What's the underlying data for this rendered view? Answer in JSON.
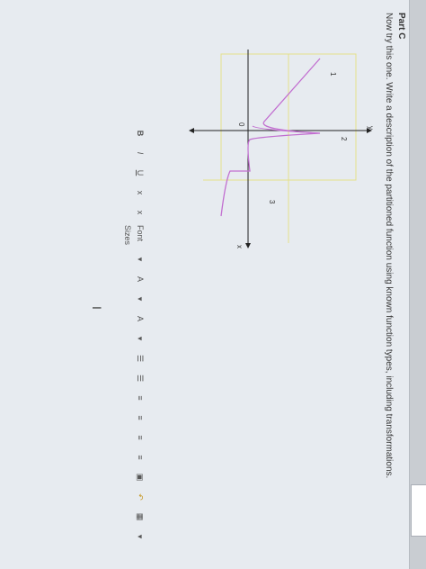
{
  "part": {
    "label": "Part C"
  },
  "prompt": {
    "text": "Now try this one. Write a description of the partitioned function using known function types, including transformations."
  },
  "graph": {
    "axis_y_label": "y",
    "axis_x_label": "x",
    "region_labels": [
      "1",
      "2",
      "3"
    ],
    "origin_label": "0",
    "colors": {
      "curve": "#c26fd0",
      "axis": "#222222",
      "partition_lines": "#e4e08a"
    }
  },
  "toolbar": {
    "bold": "B",
    "italic": "I",
    "underline": "U",
    "superscript": "x",
    "subscript": "x",
    "font_size": "Font Sizes",
    "dropdown_arrow": "▾",
    "text_color": "A",
    "highlight_color": "A",
    "numbered_list": "☰",
    "bulleted_list": "☰",
    "align_left": "≡",
    "align_center": "≡",
    "align_right": "≡",
    "indent": "≡",
    "image": "▣",
    "undo": "↶",
    "table": "▦"
  }
}
